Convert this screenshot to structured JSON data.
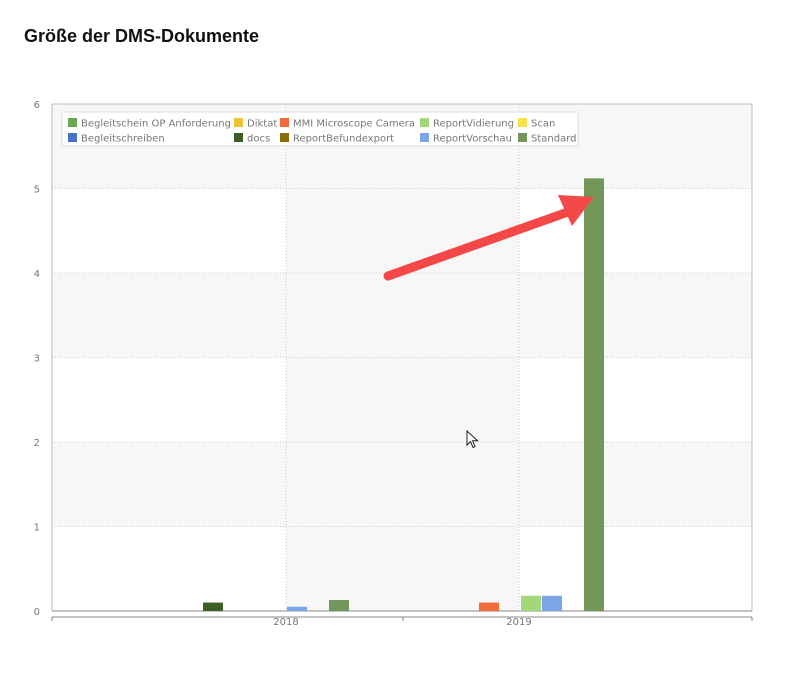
{
  "page": {
    "title": "Größe der DMS-Dokumente"
  },
  "chart_data": {
    "type": "bar",
    "title": "",
    "xlabel": "",
    "ylabel": "",
    "categories": [
      "2018",
      "2019"
    ],
    "ylim": [
      0,
      6
    ],
    "y_ticks": [
      0,
      1,
      2,
      3,
      4,
      5,
      6
    ],
    "grid": true,
    "legend_position": "top-left",
    "series": [
      {
        "name": "Begleitschein OP Anforderung",
        "color": "#6aa84f",
        "values": [
          0,
          0
        ]
      },
      {
        "name": "Begleitschreiben",
        "color": "#4472c4",
        "values": [
          0,
          0
        ]
      },
      {
        "name": "Diktat",
        "color": "#f1c232",
        "values": [
          0,
          0
        ]
      },
      {
        "name": "docs",
        "color": "#3d5e27",
        "values": [
          0.1,
          0
        ]
      },
      {
        "name": "MMI Microscope Camera",
        "color": "#f26b3a",
        "values": [
          0,
          0.1
        ]
      },
      {
        "name": "ReportBefundexport",
        "color": "#8c6d0a",
        "values": [
          0,
          0
        ]
      },
      {
        "name": "ReportVidierung",
        "color": "#a4d77a",
        "values": [
          0,
          0.18
        ]
      },
      {
        "name": "ReportVorschau",
        "color": "#7aa6e6",
        "values": [
          0.05,
          0.18
        ]
      },
      {
        "name": "Scan",
        "color": "#f7e24a",
        "values": [
          0,
          0
        ]
      },
      {
        "name": "Standard",
        "color": "#73975b",
        "values": [
          0.13,
          5.12
        ]
      }
    ]
  },
  "annotation": {
    "type": "arrow",
    "color": "#f44747"
  }
}
